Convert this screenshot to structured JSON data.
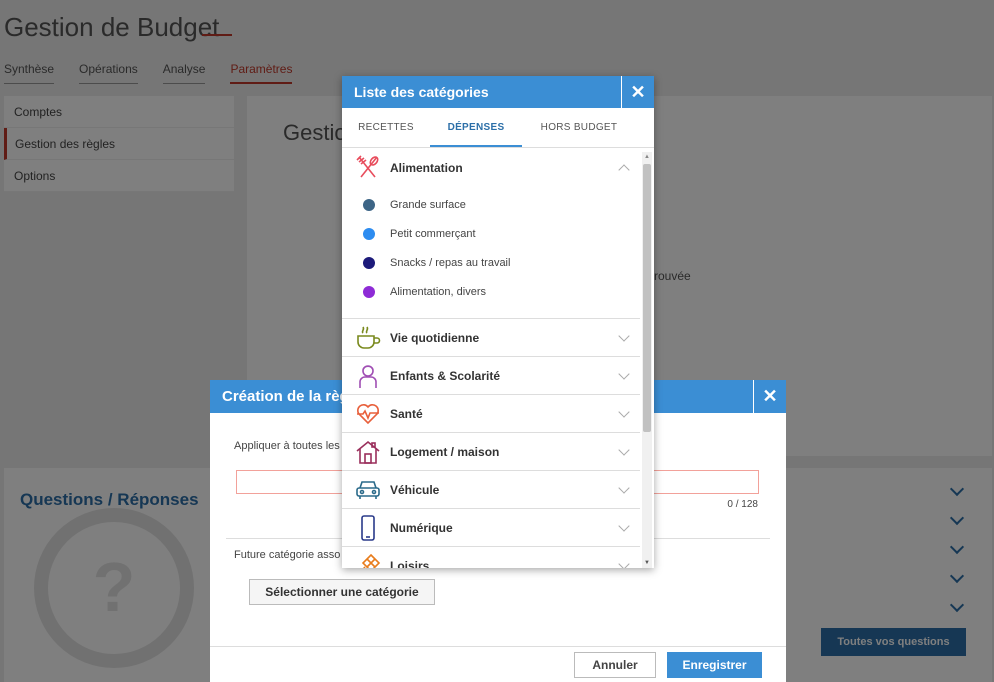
{
  "app": {
    "title": "Gestion de Budget"
  },
  "nav": [
    {
      "label": "Synthèse"
    },
    {
      "label": "Opérations"
    },
    {
      "label": "Analyse"
    },
    {
      "label": "Paramètres",
      "active": true
    }
  ],
  "sidebar": {
    "items": [
      {
        "label": "Comptes"
      },
      {
        "label": "Gestion des règles",
        "active": true
      },
      {
        "label": "Options"
      }
    ]
  },
  "main": {
    "title": "Gestio",
    "text": "rouvée"
  },
  "qa": {
    "title": "Questions / Réponses",
    "icon_char": "?",
    "all_questions_label": "Toutes vos questions"
  },
  "rule_modal": {
    "title": "Création de la règ",
    "close_label": "✕",
    "apply_label": "Appliquer à toutes les",
    "input_value": "",
    "counter": "0 / 128",
    "future_label": "Future catégorie asso",
    "select_category_label": "Sélectionner une catégorie",
    "cancel_label": "Annuler",
    "save_label": "Enregistrer"
  },
  "categories_modal": {
    "title": "Liste des catégories",
    "close_label": "✕",
    "tabs": [
      {
        "label": "RECETTES"
      },
      {
        "label": "DÉPENSES",
        "active": true
      },
      {
        "label": "HORS BUDGET"
      }
    ],
    "groups": [
      {
        "label": "Alimentation",
        "icon": "fork-knife-icon",
        "color": "#e84c5c",
        "expanded": true,
        "items": [
          {
            "label": "Grande surface",
            "color": "#3d6586"
          },
          {
            "label": "Petit commerçant",
            "color": "#2d8cf0"
          },
          {
            "label": "Snacks / repas au travail",
            "color": "#1c1a7a"
          },
          {
            "label": "Alimentation, divers",
            "color": "#8e2bd6"
          }
        ]
      },
      {
        "label": "Vie quotidienne",
        "icon": "coffee-cup-icon",
        "color": "#7a8a1e"
      },
      {
        "label": "Enfants & Scolarité",
        "icon": "child-icon",
        "color": "#a04fb4"
      },
      {
        "label": "Santé",
        "icon": "heart-pulse-icon",
        "color": "#e8603c"
      },
      {
        "label": "Logement / maison",
        "icon": "house-icon",
        "color": "#9a2f5c"
      },
      {
        "label": "Véhicule",
        "icon": "car-icon",
        "color": "#2a6a8a"
      },
      {
        "label": "Numérique",
        "icon": "phone-icon",
        "color": "#2a3a8a"
      },
      {
        "label": "Loisirs",
        "icon": "kite-icon",
        "color": "#e87c1c"
      }
    ]
  }
}
